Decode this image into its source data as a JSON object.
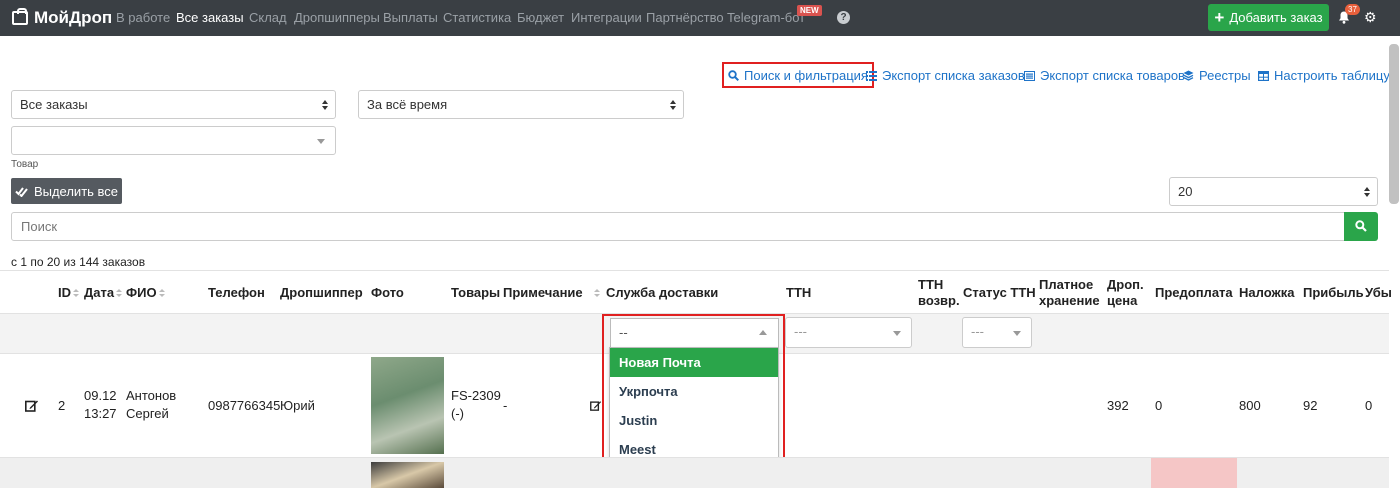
{
  "nav": {
    "brand": "МойДроп",
    "items": [
      "В работе",
      "Все заказы",
      "Склад",
      "Дропшипперы",
      "Выплаты",
      "Статистика",
      "Бюджет",
      "Интеграции",
      "Партнёрство",
      "Telegram-бот"
    ],
    "new_badge": "NEW",
    "help": "?",
    "add_order": "Добавить заказ",
    "notifications": "37"
  },
  "toolbar": {
    "search_filter": "Поиск и фильтрация",
    "export_orders": "Экспорт списка заказов",
    "export_products": "Экспорт списка товаров",
    "registries": "Реестры",
    "table_settings": "Настроить таблицу"
  },
  "filters": {
    "orders_select": "Все заказы",
    "period_select": "За всё время",
    "product_label": "Товар",
    "select_all": "Выделить все",
    "page_size": "20",
    "search_placeholder": "Поиск"
  },
  "count_text": "с 1 по 20 из 144 заказов",
  "columns": [
    "ID",
    "Дата",
    "ФИО",
    "Телефон",
    "Дропшиппер",
    "Фото",
    "Товары",
    "Примечание",
    "Служба доставки",
    "ТТН",
    "ТТН",
    "возвр.",
    "Статус ТТН",
    "Платное",
    "хранение",
    "Дроп.",
    "цена",
    "Предоплата",
    "Наложка",
    "Прибыль",
    "Убы"
  ],
  "column_filters": {
    "delivery_value": "--",
    "ttn_value": "---",
    "status_value": "---"
  },
  "delivery_options": [
    "Новая Почта",
    "Укрпочта",
    "Justin",
    "Meest"
  ],
  "rows": [
    {
      "id": "2",
      "date": "09.12",
      "time": "13:27",
      "name_last": "Антонов",
      "name_first": "Сергей",
      "phone": "0987766345",
      "dropshipper": "Юрий",
      "product": "FS-2309",
      "product_sub": "(-)",
      "note": "-",
      "drop_price": "392",
      "prepay": "0",
      "cod": "800",
      "profit": "92",
      "loss": "0"
    }
  ],
  "colors": {
    "navbar": "#3a3f44",
    "green": "#2aa54a",
    "link": "#1e73c8",
    "highlight": "#e02020"
  }
}
